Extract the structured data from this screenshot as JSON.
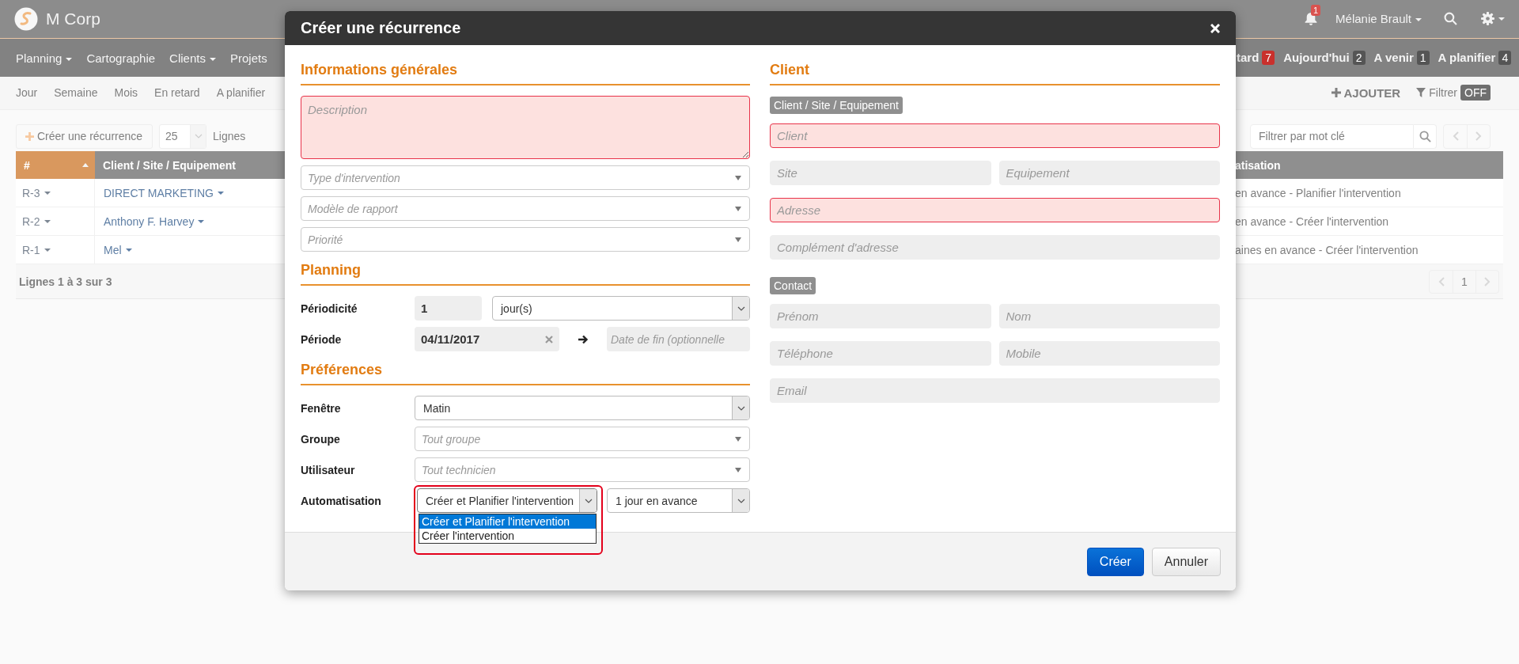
{
  "app": {
    "name": "M Corp",
    "notifications": "1",
    "user": "Mélanie Brault"
  },
  "nav": {
    "items": [
      {
        "label": "Planning",
        "dropdown": true
      },
      {
        "label": "Cartographie",
        "dropdown": false
      },
      {
        "label": "Clients",
        "dropdown": true
      },
      {
        "label": "Projets",
        "dropdown": false
      }
    ],
    "counters": [
      {
        "label": "tard",
        "count": "7",
        "alert": true
      },
      {
        "label": "Aujourd'hui",
        "count": "2",
        "alert": false
      },
      {
        "label": "A venir",
        "count": "1",
        "alert": false
      },
      {
        "label": "A planifier",
        "count": "4",
        "alert": false
      }
    ]
  },
  "subnav": {
    "items": [
      "Jour",
      "Semaine",
      "Mois",
      "En retard",
      "A planifier"
    ],
    "add": "AJOUTER",
    "filter": "Filtrer",
    "filter_state": "OFF"
  },
  "toolbar": {
    "create": "Créer une récurrence",
    "page_size": "25",
    "page_size_label": "Lignes",
    "search_placeholder": "Filtrer par mot clé"
  },
  "table": {
    "columns": [
      {
        "label": "#",
        "sorted": true
      },
      {
        "label": "Client / Site / Equipement",
        "sorted": false
      },
      {
        "label": "atisation",
        "sorted": false
      }
    ],
    "rows": [
      {
        "id": "R-3",
        "client": "DIRECT MARKETING",
        "automation": "en avance - Planifier l'intervention"
      },
      {
        "id": "R-2",
        "client": "Anthony F. Harvey",
        "automation": "en avance - Créer l'intervention"
      },
      {
        "id": "R-1",
        "client": "Mel",
        "automation": "aines en avance - Créer l'intervention"
      }
    ],
    "footer": "Lignes 1 à 3 sur 3",
    "page": "1"
  },
  "dialog": {
    "title": "Créer une récurrence",
    "general": {
      "title": "Informations générales",
      "description": {
        "placeholder": "Description",
        "invalid": true
      },
      "selects": [
        {
          "placeholder": "Type d'intervention"
        },
        {
          "placeholder": "Modèle de rapport"
        },
        {
          "placeholder": "Priorité"
        }
      ]
    },
    "planning": {
      "title": "Planning",
      "periodicity": {
        "label": "Périodicité",
        "value": "1",
        "unit": "jour(s)"
      },
      "period": {
        "label": "Période",
        "start": "04/11/2017",
        "end_placeholder": "Date de fin (optionnelle"
      }
    },
    "preferences": {
      "title": "Préférences",
      "rows": [
        {
          "label": "Fenêtre",
          "kind": "native",
          "value": "Matin"
        },
        {
          "label": "Groupe",
          "kind": "chosen",
          "placeholder": "Tout groupe"
        },
        {
          "label": "Utilisateur",
          "kind": "chosen",
          "placeholder": "Tout technicien"
        },
        {
          "label": "Automatisation",
          "kind": "pair",
          "value": "Créer et Planifier l'intervention",
          "value2": "1 jour en avance",
          "options": [
            {
              "label": "Créer et Planifier l'intervention",
              "selected": true
            },
            {
              "label": "Créer l'intervention",
              "selected": false
            }
          ]
        }
      ]
    },
    "client": {
      "title": "Client",
      "groups": [
        {
          "badge": "Client / Site / Equipement",
          "rows": [
            {
              "fields": [
                {
                  "placeholder": "Client",
                  "invalid": true
                }
              ]
            },
            {
              "fields": [
                {
                  "placeholder": "Site",
                  "invalid": false
                },
                {
                  "placeholder": "Equipement",
                  "invalid": false
                }
              ]
            },
            {
              "fields": [
                {
                  "placeholder": "Adresse",
                  "invalid": true
                }
              ]
            },
            {
              "fields": [
                {
                  "placeholder": "Complément d'adresse",
                  "invalid": false
                }
              ]
            }
          ]
        },
        {
          "badge": "Contact",
          "rows": [
            {
              "fields": [
                {
                  "placeholder": "Prénom",
                  "invalid": false
                },
                {
                  "placeholder": "Nom",
                  "invalid": false
                }
              ]
            },
            {
              "fields": [
                {
                  "placeholder": "Téléphone",
                  "invalid": false
                },
                {
                  "placeholder": "Mobile",
                  "invalid": false
                }
              ]
            },
            {
              "fields": [
                {
                  "placeholder": "Email",
                  "invalid": false
                }
              ]
            }
          ]
        }
      ]
    },
    "buttons": [
      {
        "label": "Créer",
        "primary": true
      },
      {
        "label": "Annuler",
        "primary": false
      }
    ]
  }
}
